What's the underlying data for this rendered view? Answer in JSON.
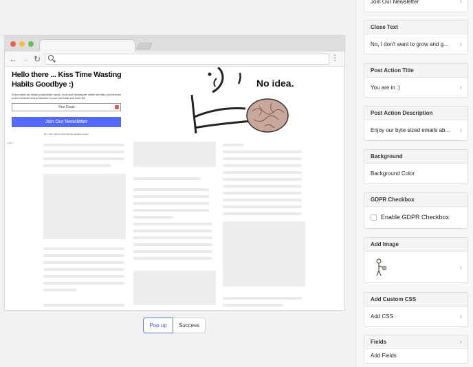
{
  "preview": {
    "popup": {
      "title": "Hello there ... Kiss Time Wasting Habits Goodbye :)",
      "description": "Every week we share productivity hacks, tools and techniques which will help you become more focussed and productive in your personal and work life.",
      "email_placeholder": "Your Email",
      "button_label": "Join Our Newsletter",
      "close_text": "No, I don't want to grow and get valuable content",
      "image_text": "No idea."
    },
    "tabs": [
      {
        "label": "Pop up",
        "active": true
      },
      {
        "label": "Success",
        "active": false
      }
    ],
    "accent_color": "#5568fe"
  },
  "settings": {
    "button_text": {
      "value": "Join Our Newsletter"
    },
    "close_text": {
      "title": "Close Text",
      "value": "No, I don't want to grow and g..."
    },
    "post_action_title": {
      "title": "Post Action Title",
      "value": "You are in :)"
    },
    "post_action_description": {
      "title": "Post Action Description",
      "value": "Enjoy our byte sized emails ab..."
    },
    "background": {
      "title": "Background",
      "value": "Background Color"
    },
    "gdpr": {
      "title": "GDPR Checkbox",
      "label": "Enable GDPR Checkbox",
      "checked": false
    },
    "add_image": {
      "title": "Add Image"
    },
    "custom_css": {
      "title": "Add Custom CSS",
      "value": "Add CSS"
    },
    "fields": {
      "title": "Fields",
      "value": "Add Fields"
    }
  }
}
